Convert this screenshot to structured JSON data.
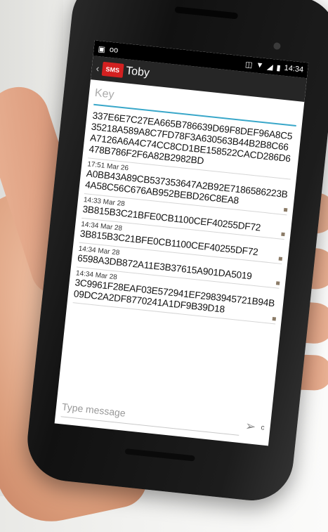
{
  "status": {
    "time": "14:34"
  },
  "actionbar": {
    "logo_text": "SMS",
    "contact": "Toby"
  },
  "key_field": {
    "placeholder": "Key"
  },
  "messages": [
    {
      "time": "",
      "text": "337E6E7C27EA665B786639D69F8DEF96A8C535218A589A8C7FD78F3A630563B44B2B8C66A7126A6A4C74CC8CD1BE158522CACD286D6478B786F2F6A82B2982BD"
    },
    {
      "time": "17:51 Mar 26",
      "text": "A0BB43A89CB537353647A2B92E7186586223B4A58C56C676AB952BEBD26C8EA8"
    },
    {
      "time": "14:33 Mar 28",
      "text": "3B815B3C21BFE0CB1100CEF40255DF72"
    },
    {
      "time": "14:34 Mar 28",
      "text": "3B815B3C21BFE0CB1100CEF40255DF72"
    },
    {
      "time": "14:34 Mar 28",
      "text": "6598A3DB872A11E3B37615A901DA5019"
    },
    {
      "time": "14:34 Mar 28",
      "text": "3C9961F28EAF03E572941EF2983945721B94B09DC2A2DF8770241A1DF9B39D18"
    }
  ],
  "compose": {
    "placeholder": "Type message",
    "counter": "c"
  }
}
